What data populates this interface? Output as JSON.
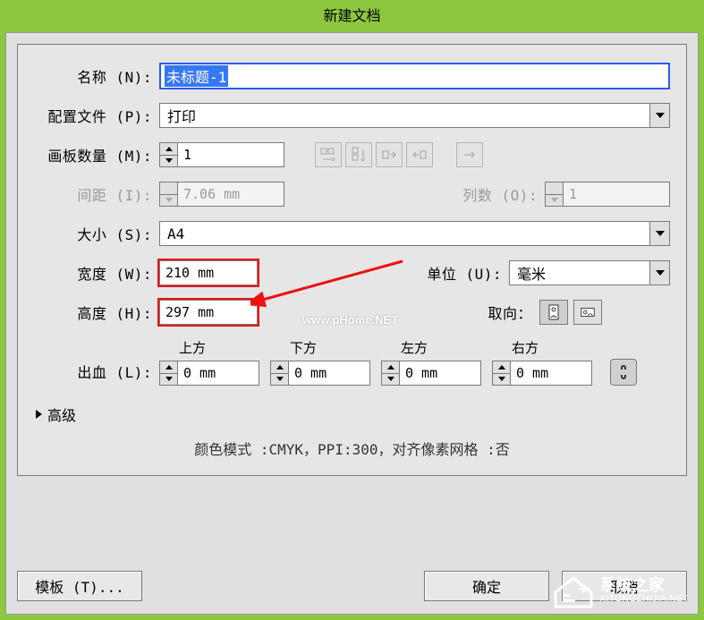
{
  "title": "新建文档",
  "labels": {
    "name": "名称 (N):",
    "profile": "配置文件 (P):",
    "artboards": "画板数量 (M):",
    "spacing": "间距 (I):",
    "columns": "列数 (O):",
    "size": "大小 (S):",
    "width": "宽度 (W):",
    "height": "高度 (H):",
    "unit": "单位 (U):",
    "orientation": "取向：",
    "bleed": "出血 (L):",
    "top": "上方",
    "bottom": "下方",
    "left": "左方",
    "right": "右方",
    "advanced": "高级"
  },
  "values": {
    "name": "未标题-1",
    "profile": "打印",
    "artboards": "1",
    "spacing": "7.06 mm",
    "columns": "1",
    "size": "A4",
    "width": "210 mm",
    "height": "297 mm",
    "unit": "毫米",
    "bleed_top": "0 mm",
    "bleed_bottom": "0 mm",
    "bleed_left": "0 mm",
    "bleed_right": "0 mm"
  },
  "summary": "颜色模式 :CMYK，PPI:300，对齐像素网格 :否",
  "buttons": {
    "template": "模板 (T)...",
    "ok": "确定",
    "cancel": "取消"
  },
  "watermarks": {
    "phome": "www.pHome.NET",
    "site_zh": "系统之家",
    "site_en": "XITONGZHIJIA.NET"
  }
}
